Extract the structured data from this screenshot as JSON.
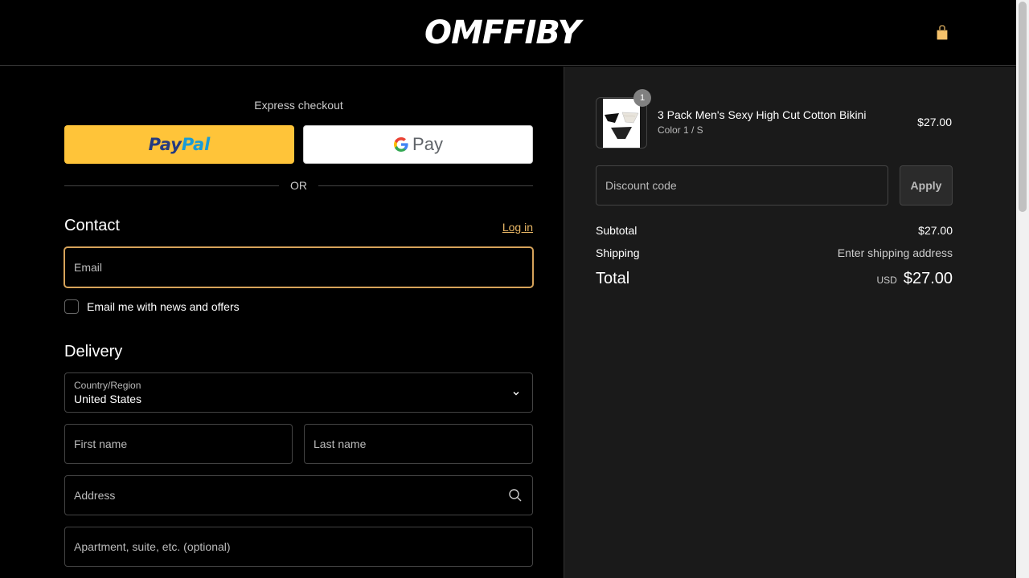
{
  "header": {
    "logo": "OMFFIBY",
    "cart_icon": "shopping-bag-icon"
  },
  "express": {
    "label": "Express checkout",
    "paypal_part1": "Pay",
    "paypal_part2": "Pal",
    "gpay_label": "Pay",
    "or_label": "OR"
  },
  "contact": {
    "title": "Contact",
    "login_label": "Log in",
    "email_placeholder": "Email",
    "newsletter_label": "Email me with news and offers"
  },
  "delivery": {
    "title": "Delivery",
    "country_label": "Country/Region",
    "country_value": "United States",
    "first_name_placeholder": "First name",
    "last_name_placeholder": "Last name",
    "address_placeholder": "Address",
    "apartment_placeholder": "Apartment, suite, etc. (optional)"
  },
  "order": {
    "quantity": "1",
    "product_name": "3 Pack Men's Sexy High Cut Cotton Bikini",
    "product_variant": "Color 1 / S",
    "product_price": "$27.00",
    "discount_placeholder": "Discount code",
    "apply_label": "Apply",
    "subtotal_label": "Subtotal",
    "subtotal_value": "$27.00",
    "shipping_label": "Shipping",
    "shipping_value": "Enter shipping address",
    "total_label": "Total",
    "total_currency": "USD",
    "total_value": "$27.00"
  },
  "colors": {
    "accent": "#d6a35a",
    "link": "#e8b665",
    "paypal_yellow": "#ffc439",
    "summary_bg": "#1a1a1a"
  }
}
